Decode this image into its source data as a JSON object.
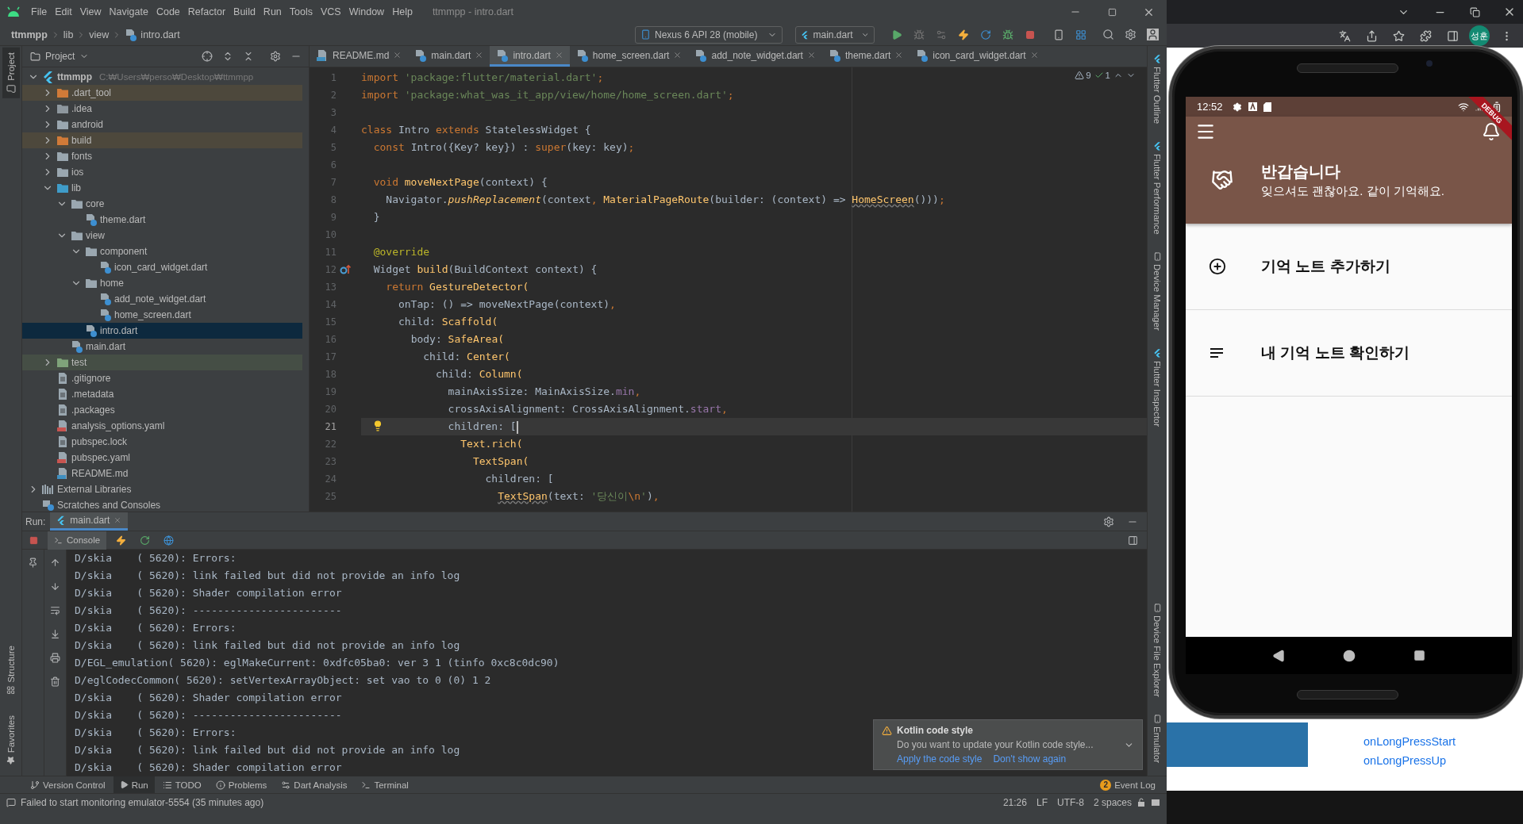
{
  "ide": {
    "menu": [
      "File",
      "Edit",
      "View",
      "Navigate",
      "Code",
      "Refactor",
      "Build",
      "Run",
      "Tools",
      "VCS",
      "Window",
      "Help"
    ],
    "title": "ttmmpp - intro.dart",
    "breadcrumbs": [
      "ttmmpp",
      "lib",
      "view",
      "intro.dart"
    ],
    "device": "Nexus 6 API 28 (mobile)",
    "run_config": "main.dart",
    "left_tabs": [
      "Project",
      "Structure",
      "Favorites"
    ],
    "right_tabs_top": [
      "Flutter Outline",
      "Flutter Performance",
      "Device Manager",
      "Flutter Inspector"
    ],
    "right_tabs_bottom": [
      "Device File Explorer",
      "Emulator"
    ],
    "project_panel": {
      "title": "Project",
      "tree": [
        {
          "label": "ttmmpp",
          "path": "C:₩Users₩perso₩Desktop₩ttmmpp",
          "kind": "project",
          "expanded": true,
          "selected": false,
          "children": [
            {
              "label": ".dart_tool",
              "kind": "excluded",
              "expanded": false,
              "selected": false
            },
            {
              "label": ".idea",
              "kind": "config",
              "expanded": false,
              "selected": false
            },
            {
              "label": "android",
              "kind": "module",
              "expanded": false,
              "selected": false
            },
            {
              "label": "build",
              "kind": "excluded",
              "expanded": false,
              "selected": false
            },
            {
              "label": "fonts",
              "kind": "folder",
              "expanded": false,
              "selected": false
            },
            {
              "label": "ios",
              "kind": "module",
              "expanded": false,
              "selected": false
            },
            {
              "label": "lib",
              "kind": "source",
              "expanded": true,
              "selected": false,
              "children": [
                {
                  "label": "core",
                  "kind": "folder",
                  "expanded": true,
                  "selected": false,
                  "children": [
                    {
                      "label": "theme.dart",
                      "kind": "dart",
                      "selected": false
                    }
                  ]
                },
                {
                  "label": "view",
                  "kind": "folder",
                  "expanded": true,
                  "selected": false,
                  "children": [
                    {
                      "label": "component",
                      "kind": "folder",
                      "expanded": true,
                      "selected": false,
                      "children": [
                        {
                          "label": "icon_card_widget.dart",
                          "kind": "dart",
                          "selected": false
                        }
                      ]
                    },
                    {
                      "label": "home",
                      "kind": "folder",
                      "expanded": true,
                      "selected": false,
                      "children": [
                        {
                          "label": "add_note_widget.dart",
                          "kind": "dart",
                          "selected": false
                        },
                        {
                          "label": "home_screen.dart",
                          "kind": "dart",
                          "selected": false
                        }
                      ]
                    },
                    {
                      "label": "intro.dart",
                      "kind": "dart",
                      "selected": true
                    }
                  ]
                },
                {
                  "label": "main.dart",
                  "kind": "dart",
                  "selected": false
                }
              ]
            },
            {
              "label": "test",
              "kind": "test",
              "expanded": false,
              "selected": false
            },
            {
              "label": ".gitignore",
              "kind": "ignore",
              "selected": false
            },
            {
              "label": ".metadata",
              "kind": "text",
              "selected": false
            },
            {
              "label": ".packages",
              "kind": "text",
              "selected": false
            },
            {
              "label": "analysis_options.yaml",
              "kind": "yaml",
              "selected": false
            },
            {
              "label": "pubspec.lock",
              "kind": "text",
              "selected": false
            },
            {
              "label": "pubspec.yaml",
              "kind": "yaml",
              "selected": false
            },
            {
              "label": "README.md",
              "kind": "markdown",
              "selected": false
            }
          ]
        },
        {
          "label": "External Libraries",
          "kind": "library",
          "expanded": false,
          "selected": false
        },
        {
          "label": "Scratches and Consoles",
          "kind": "scratches",
          "selected": false
        }
      ]
    },
    "editor": {
      "tabs": [
        {
          "label": "README.md",
          "kind": "markdown",
          "selected": false
        },
        {
          "label": "main.dart",
          "kind": "dart",
          "selected": false
        },
        {
          "label": "intro.dart",
          "kind": "dart",
          "selected": true
        },
        {
          "label": "home_screen.dart",
          "kind": "dart",
          "selected": false
        },
        {
          "label": "add_note_widget.dart",
          "kind": "dart",
          "selected": false
        },
        {
          "label": "theme.dart",
          "kind": "dart",
          "selected": false
        },
        {
          "label": "icon_card_widget.dart",
          "kind": "dart",
          "selected": false
        }
      ],
      "warnings": "9",
      "checks": "1",
      "lines": [
        {
          "n": "1",
          "kind": "code",
          "current": false,
          "tokens": [
            {
              "kind": "kw",
              "text": "import"
            },
            {
              "kind": "str",
              "text": " 'package:flutter/material.dart'"
            },
            {
              "kind": "kw",
              "text": ";"
            }
          ]
        },
        {
          "n": "2",
          "kind": "code",
          "current": false,
          "tokens": [
            {
              "kind": "kw",
              "text": "import"
            },
            {
              "kind": "str",
              "text": " 'package:what_was_it_app/view/home/home_screen.dart'"
            },
            {
              "kind": "kw",
              "text": ";"
            }
          ]
        },
        {
          "n": "3",
          "kind": "code",
          "current": false
        },
        {
          "n": "4",
          "kind": "code",
          "current": false,
          "tokens": [
            {
              "kind": "kw",
              "text": "class"
            },
            {
              "kind": "plain",
              "text": " Intro "
            },
            {
              "kind": "kw",
              "text": "extends"
            },
            {
              "kind": "plain",
              "text": " StatelessWidget {"
            }
          ]
        },
        {
          "n": "5",
          "kind": "code",
          "current": false,
          "tokens": [
            {
              "kind": "kw",
              "text": "  const"
            },
            {
              "kind": "plain",
              "text": " Intro({Key? key}) : "
            },
            {
              "kind": "kw",
              "text": "super"
            },
            {
              "kind": "plain",
              "text": "(key: key)"
            },
            {
              "kind": "kw",
              "text": ";"
            }
          ]
        },
        {
          "n": "6",
          "kind": "code",
          "current": false
        },
        {
          "n": "7",
          "kind": "code",
          "current": false,
          "tokens": [
            {
              "kind": "kw",
              "text": "  void"
            },
            {
              "kind": "fn",
              "text": " moveNextPage"
            },
            {
              "kind": "plain",
              "text": "(context) {"
            }
          ]
        },
        {
          "n": "8",
          "kind": "code",
          "current": false,
          "tokens": [
            {
              "kind": "plain",
              "text": "    Navigator."
            },
            {
              "kind": "fni",
              "text": "pushReplacement"
            },
            {
              "kind": "plain",
              "text": "(context"
            },
            {
              "kind": "kw",
              "text": ","
            },
            {
              "kind": "fn",
              "text": " MaterialPageRoute"
            },
            {
              "kind": "plain",
              "text": "(builder: (context) => "
            },
            {
              "kind": "fnw",
              "text": "HomeScreen"
            },
            {
              "kind": "plain",
              "text": "()))"
            },
            {
              "kind": "kw",
              "text": ";"
            }
          ]
        },
        {
          "n": "9",
          "kind": "code",
          "current": false,
          "tokens": [
            {
              "kind": "plain",
              "text": "  }"
            }
          ]
        },
        {
          "n": "10",
          "kind": "code",
          "current": false
        },
        {
          "n": "11",
          "kind": "code",
          "current": false,
          "tokens": [
            {
              "kind": "meta",
              "text": "  @override"
            }
          ]
        },
        {
          "n": "12",
          "kind": "override",
          "current": false,
          "tokens": [
            {
              "kind": "plain",
              "text": "  Widget "
            },
            {
              "kind": "fn",
              "text": "build"
            },
            {
              "kind": "plain",
              "text": "(BuildContext context) {"
            }
          ]
        },
        {
          "n": "13",
          "kind": "code",
          "current": false,
          "tokens": [
            {
              "kind": "kw",
              "text": "    return"
            },
            {
              "kind": "fn",
              "text": " GestureDetector("
            }
          ]
        },
        {
          "n": "14",
          "kind": "code",
          "current": false,
          "tokens": [
            {
              "kind": "plain",
              "text": "      onTap: () => moveNextPage(context)"
            },
            {
              "kind": "kw",
              "text": ","
            }
          ]
        },
        {
          "n": "15",
          "kind": "code",
          "current": false,
          "tokens": [
            {
              "kind": "plain",
              "text": "      child: "
            },
            {
              "kind": "fn",
              "text": "Scaffold("
            }
          ]
        },
        {
          "n": "16",
          "kind": "code",
          "current": false,
          "tokens": [
            {
              "kind": "plain",
              "text": "        body: "
            },
            {
              "kind": "fn",
              "text": "SafeArea("
            }
          ]
        },
        {
          "n": "17",
          "kind": "code",
          "current": false,
          "tokens": [
            {
              "kind": "plain",
              "text": "          child: "
            },
            {
              "kind": "fn",
              "text": "Center("
            }
          ]
        },
        {
          "n": "18",
          "kind": "code",
          "current": false,
          "tokens": [
            {
              "kind": "plain",
              "text": "            child: "
            },
            {
              "kind": "fn",
              "text": "Column("
            }
          ]
        },
        {
          "n": "19",
          "kind": "code",
          "current": false,
          "tokens": [
            {
              "kind": "plain",
              "text": "              mainAxisSize: MainAxisSize."
            },
            {
              "kind": "field",
              "text": "min"
            },
            {
              "kind": "kw",
              "text": ","
            }
          ]
        },
        {
          "n": "20",
          "kind": "code",
          "current": false,
          "tokens": [
            {
              "kind": "plain",
              "text": "              crossAxisAlignment: CrossAxisAlignment."
            },
            {
              "kind": "field",
              "text": "start"
            },
            {
              "kind": "kw",
              "text": ","
            }
          ]
        },
        {
          "n": "21",
          "kind": "bulb",
          "current": true,
          "tokens": [
            {
              "kind": "plain",
              "text": "              children: ["
            }
          ]
        },
        {
          "n": "22",
          "kind": "code",
          "current": false,
          "tokens": [
            {
              "kind": "fn",
              "text": "                Text.rich("
            }
          ]
        },
        {
          "n": "23",
          "kind": "code",
          "current": false,
          "tokens": [
            {
              "kind": "fn",
              "text": "                  TextSpan("
            }
          ]
        },
        {
          "n": "24",
          "kind": "code",
          "current": false,
          "tokens": [
            {
              "kind": "plain",
              "text": "                    children: ["
            }
          ]
        },
        {
          "n": "25",
          "kind": "code",
          "current": false,
          "tokens": [
            {
              "kind": "fnw",
              "text": "                      TextSpan"
            },
            {
              "kind": "plain",
              "text": "(text: "
            },
            {
              "kind": "str",
              "text": "'당신이"
            },
            {
              "kind": "esc",
              "text": "\\n"
            },
            {
              "kind": "str",
              "text": "'"
            },
            {
              "kind": "plain",
              "text": ")"
            },
            {
              "kind": "kw",
              "text": ","
            }
          ]
        }
      ]
    },
    "run": {
      "label": "Run:",
      "tab": "main.dart",
      "console_tab": "Console",
      "lines": [
        "D/skia    ( 5620): Errors:",
        "D/skia    ( 5620): link failed but did not provide an info log",
        "D/skia    ( 5620): Shader compilation error",
        "D/skia    ( 5620): ------------------------",
        "D/skia    ( 5620): Errors:",
        "D/skia    ( 5620): link failed but did not provide an info log",
        "D/EGL_emulation( 5620): eglMakeCurrent: 0xdfc05ba0: ver 3 1 (tinfo 0xc8c0dc90)",
        "D/eglCodecCommon( 5620): setVertexArrayObject: set vao to 0 (0) 1 2",
        "D/skia    ( 5620): Shader compilation error",
        "D/skia    ( 5620): ------------------------",
        "D/skia    ( 5620): Errors:",
        "D/skia    ( 5620): link failed but did not provide an info log",
        "D/skia    ( 5620): Shader compilation error"
      ]
    },
    "notification": {
      "title": "Kotlin code style",
      "message": "Do you want to update your Kotlin code style...",
      "actions": [
        "Apply the code style",
        "Don't show again"
      ]
    },
    "tool_tabs": [
      {
        "label": "Version Control",
        "kind": "vcs",
        "selected": false
      },
      {
        "label": "Run",
        "kind": "run",
        "selected": true
      },
      {
        "label": "TODO",
        "kind": "todo",
        "selected": false
      },
      {
        "label": "Problems",
        "kind": "problems",
        "selected": false
      },
      {
        "label": "Dart Analysis",
        "kind": "dart",
        "selected": false
      },
      {
        "label": "Terminal",
        "kind": "terminal",
        "selected": false
      }
    ],
    "event_log": {
      "label": "Event Log",
      "count": "2"
    },
    "status": {
      "message": "Failed to start monitoring emulator-5554 (35 minutes ago)",
      "items": [
        "21:26",
        "LF",
        "UTF-8",
        "2 spaces"
      ]
    }
  },
  "browser": {
    "avatar": "성훈",
    "links": [
      "onLongPressStart",
      "onLongPressUp"
    ]
  },
  "phone": {
    "time": "12:52",
    "banner": "DEBUG",
    "greeting": {
      "title": "반갑습니다",
      "subtitle": "잊으셔도 괜찮아요. 같이 기억해요."
    },
    "menu": [
      {
        "label": "기억 노트 추가하기",
        "kind": "add"
      },
      {
        "label": "내 기억 노트 확인하기",
        "kind": "list"
      }
    ]
  }
}
